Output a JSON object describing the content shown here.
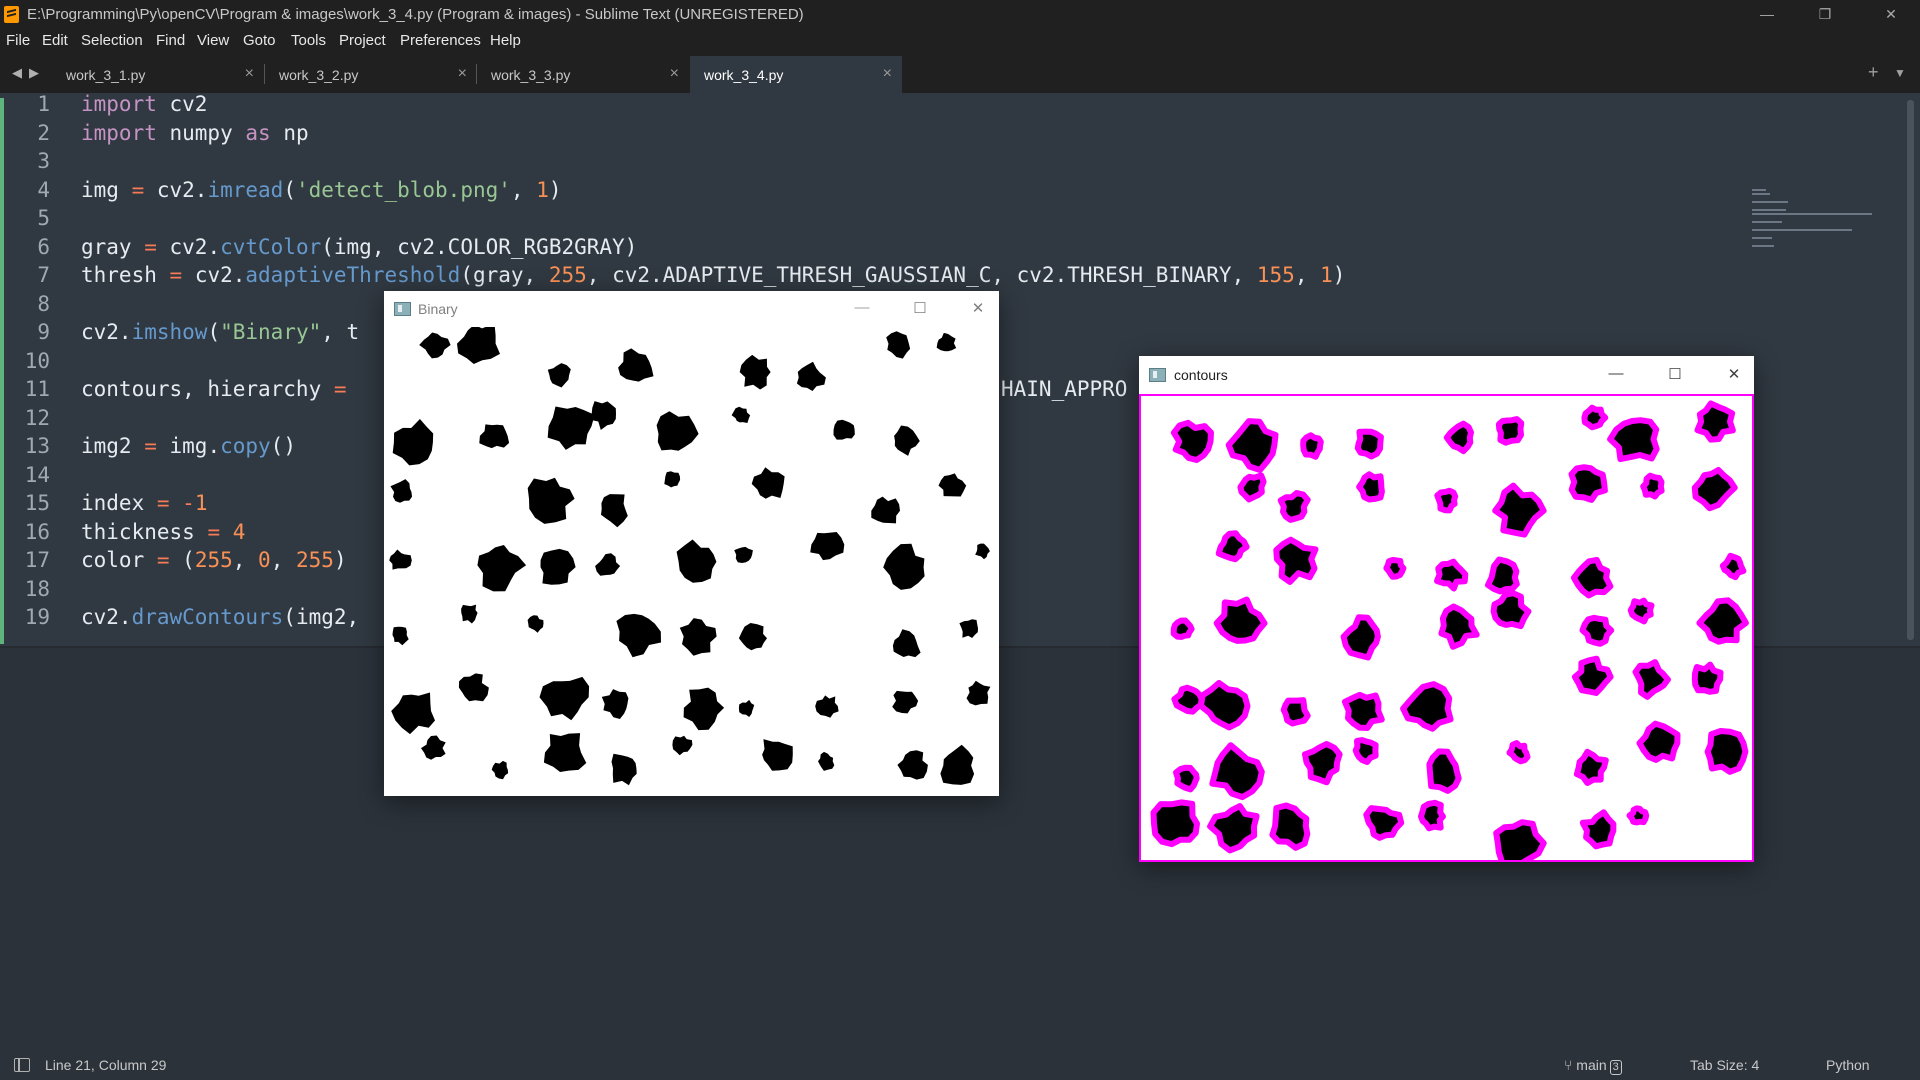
{
  "window": {
    "title": "E:\\Programming\\Py\\openCV\\Program & images\\work_3_4.py (Program & images) - Sublime Text (UNREGISTERED)",
    "minimize": "—",
    "maximize": "❐",
    "close": "✕"
  },
  "menu": [
    "File",
    "Edit",
    "Selection",
    "Find",
    "View",
    "Goto",
    "Tools",
    "Project",
    "Preferences",
    "Help"
  ],
  "tabs": [
    {
      "label": "work_3_1.py",
      "close": "×"
    },
    {
      "label": "work_3_2.py",
      "close": "×"
    },
    {
      "label": "work_3_3.py",
      "close": "×"
    },
    {
      "label": "work_3_4.py",
      "close": "×"
    }
  ],
  "tab_controls": {
    "back": "◀",
    "forward": "▶",
    "new_tab": "+",
    "dropdown": "▼"
  },
  "gutter": [
    "1",
    "2",
    "3",
    "4",
    "5",
    "6",
    "7",
    "8",
    "9",
    "10",
    "11",
    "12",
    "13",
    "14",
    "15",
    "16",
    "17",
    "18",
    "19"
  ],
  "code": {
    "l1": {
      "kw": "import",
      "rest": " cv2"
    },
    "l2": {
      "kw": "import",
      "mid": " numpy ",
      "kw2": "as",
      "rest": " np"
    },
    "l4": {
      "a": "img ",
      "op": "=",
      "b": " cv2.",
      "fn": "imread",
      "c": "(",
      "str": "'detect_blob.png'",
      "d": ", ",
      "num": "1",
      "e": ")"
    },
    "l6": {
      "a": "gray ",
      "op": "=",
      "b": " cv2.",
      "fn": "cvtColor",
      "c": "(img, cv2.COLOR_RGB2GRAY)"
    },
    "l7": {
      "a": "thresh ",
      "op": "=",
      "b": " cv2.",
      "fn": "adaptiveThreshold",
      "c": "(gray, ",
      "n1": "255",
      "d": ", cv2.ADAPTIVE_THRESH_GAUSSIAN_C, cv2.THRESH_BINARY, ",
      "n2": "155",
      "e": ", ",
      "n3": "1",
      "f": ")"
    },
    "l9": {
      "a": "cv2.",
      "fn": "imshow",
      "b": "(",
      "str": "\"Binary\"",
      "c": ", t"
    },
    "l11": {
      "a": "contours, hierarchy ",
      "op": "=",
      "tail": "HAIN_APPRO"
    },
    "l13": {
      "a": "img2 ",
      "op": "=",
      "b": " img.",
      "fn": "copy",
      "c": "()"
    },
    "l15": {
      "a": "index ",
      "op": "=",
      "b": " ",
      "op2": "-",
      "num": "1"
    },
    "l16": {
      "a": "thickness ",
      "op": "=",
      "b": " ",
      "num": "4"
    },
    "l17": {
      "a": "color ",
      "op": "=",
      "b": " (",
      "n1": "255",
      "c": ", ",
      "n2": "0",
      "d": ", ",
      "n3": "255",
      "e": ")"
    },
    "l19": {
      "a": "cv2.",
      "fn": "drawContours",
      "b": "(img2,"
    }
  },
  "binary_window": {
    "title": "Binary",
    "minimize": "—",
    "maximize": "☐",
    "close": "✕"
  },
  "contours_window": {
    "title": "contours",
    "minimize": "—",
    "maximize": "☐",
    "close": "✕"
  },
  "status": {
    "position": "Line 21, Column 29",
    "branch": "main",
    "branch_count": "3",
    "tab_size": "Tab Size: 4",
    "syntax": "Python"
  },
  "colors": {
    "editor_bg": "#303841",
    "contour": "#ff00ff",
    "keyword": "#c594c5",
    "function": "#6699cc",
    "string": "#99c794",
    "number": "#f99157"
  },
  "icons": {
    "branch": "⑂"
  }
}
